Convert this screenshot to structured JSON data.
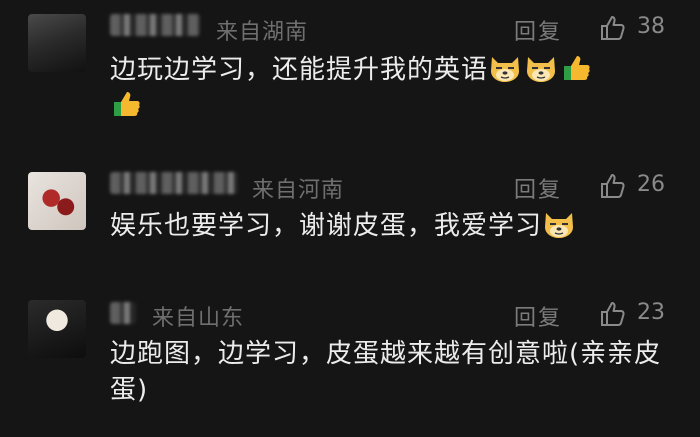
{
  "comments": [
    {
      "location": "来自湖南",
      "reply": "回复",
      "likes": "38",
      "text": "边玩边学习，还能提升我的英语"
    },
    {
      "location": "来自河南",
      "reply": "回复",
      "likes": "26",
      "text": "娱乐也要学习，谢谢皮蛋，我爱学习"
    },
    {
      "location": "来自山东",
      "reply": "回复",
      "likes": "23",
      "text": "边跑图，边学习，皮蛋越来越有创意啦(亲亲皮蛋)"
    }
  ],
  "icons": {
    "like": "thumb-up-icon",
    "doge": "doge-emoji-icon",
    "thumbs": "thumbs-up-emoji-icon"
  },
  "colors": {
    "background": "#151515",
    "text": "#ececec",
    "meta": "#6f6f6f",
    "doge": "#f2c04a",
    "thumb_emoji": "#f5b82e"
  }
}
